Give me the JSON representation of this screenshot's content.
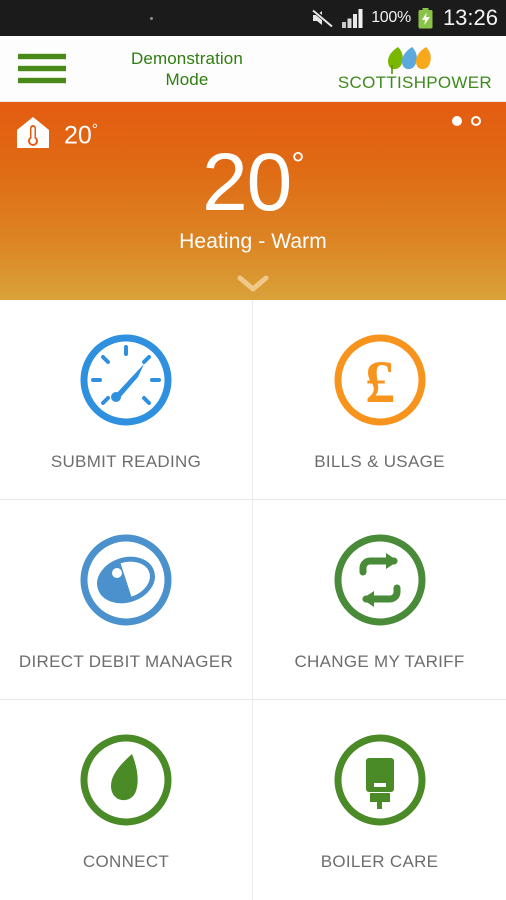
{
  "statusbar": {
    "mute_icon": "volume-mute-icon",
    "signal_icon": "signal-bars-icon",
    "battery_percent": "100%",
    "battery_icon": "battery-charging-icon",
    "clock": "13:26"
  },
  "header": {
    "menu_icon": "hamburger-menu-icon",
    "title": "Demonstration\nMode",
    "title_line1": "Demonstration",
    "title_line2": "Mode",
    "brand": "SCOTTISHPOWER",
    "brand_color": "#3f8a1d"
  },
  "hero": {
    "home_icon": "home-thermometer-icon",
    "home_temp": "20",
    "home_temp_degree": "°",
    "big_temp": "20",
    "big_temp_degree": "°",
    "status": "Heating - Warm",
    "chevron_icon": "chevron-down-icon",
    "pager": {
      "total": 2,
      "active": 1
    },
    "gradient_from": "#e45c11",
    "gradient_to": "#d9a23a"
  },
  "grid": {
    "tiles": [
      {
        "label": "SUBMIT READING",
        "icon": "meter-gauge-icon",
        "color": "#2f90e0"
      },
      {
        "label": "BILLS & USAGE",
        "icon": "pound-sterling-icon",
        "color": "#f7941d"
      },
      {
        "label": "DIRECT DEBIT MANAGER",
        "icon": "direct-debit-icon",
        "color": "#4a91cd"
      },
      {
        "label": "CHANGE MY TARIFF",
        "icon": "swap-arrows-icon",
        "color": "#4a8b3a"
      },
      {
        "label": "CONNECT",
        "icon": "leaf-drop-icon",
        "color": "#4a8b28"
      },
      {
        "label": "BOILER CARE",
        "icon": "boiler-icon",
        "color": "#4a8b28"
      }
    ]
  }
}
